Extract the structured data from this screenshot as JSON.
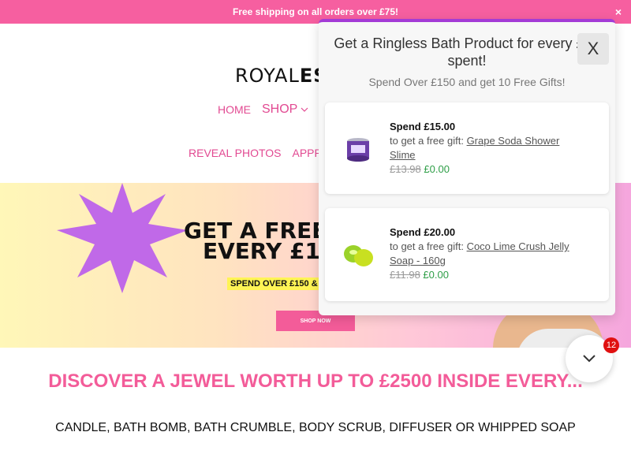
{
  "announcement": {
    "text": "Free shipping on all orders over £75!",
    "close": "×"
  },
  "logo": {
    "part1": "ROYAL",
    "part2": "ES"
  },
  "nav": {
    "row1": [
      "HOME",
      "SHOP"
    ],
    "row2": [
      "REVEAL PHOTOS",
      "APPRA"
    ]
  },
  "hero": {
    "title_line1": "GET A FREE",
    "title_line2": "EVERY £1",
    "subtitle": "SPEND OVER £150 &",
    "button": "SHOP NOW"
  },
  "discover": "DISCOVER A JEWEL WORTH UP TO £2500 INSIDE EVERY...",
  "products_line": "CANDLE, BATH BOMB, BATH CRUMBLE, BODY SCRUB, DIFFUSER OR WHIPPED SOAP",
  "popup": {
    "title": "Get a Ringless Bath Product for every £15 spent!",
    "subtitle": "Spend Over £150 and get 10 Free Gifts!",
    "close": "X",
    "gifts": [
      {
        "spend": "Spend £15.00",
        "intro": "to get a free gift: ",
        "name": "Grape Soda Shower Slime",
        "old_price": "£13.98",
        "new_price": "£0.00"
      },
      {
        "spend": "Spend £20.00",
        "intro": "to get a free gift: ",
        "name": "Coco Lime Crush Jelly Soap - 160g",
        "old_price": "£11.98",
        "new_price": "£0.00"
      }
    ]
  },
  "widget": {
    "badge": "12"
  },
  "colors": {
    "brand_pink": "#f35c99",
    "popup_accent": "#a33bd6",
    "free_green": "#2e9e47"
  }
}
